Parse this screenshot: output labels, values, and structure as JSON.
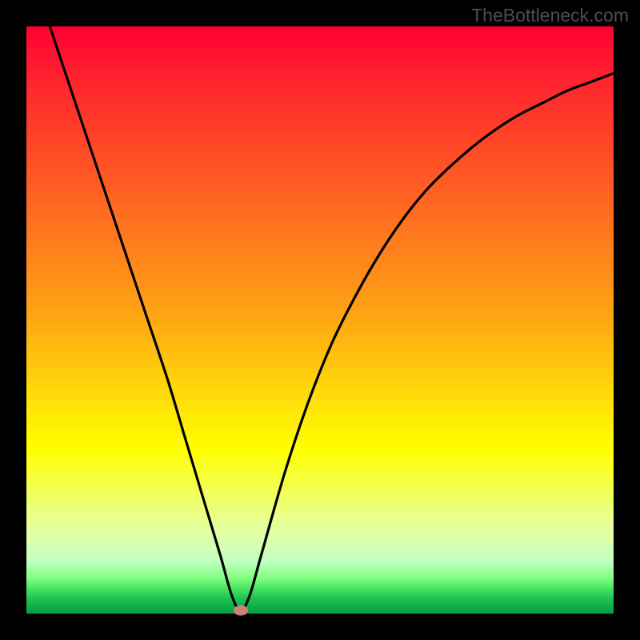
{
  "watermark": "TheBottleneck.com",
  "chart_data": {
    "type": "line",
    "title": "",
    "xlabel": "",
    "ylabel": "",
    "xlim": [
      0,
      100
    ],
    "ylim": [
      0,
      100
    ],
    "background_gradient": {
      "top_color": "#ff0030",
      "middle_color": "#ffff00",
      "bottom_color": "#00a040",
      "meaning": "vertical gradient red-yellow-green indicating bottleneck severity (high at top, low at bottom)"
    },
    "series": [
      {
        "name": "bottleneck-curve",
        "x": [
          4,
          8,
          12,
          16,
          20,
          24,
          27,
          30,
          33,
          35,
          36.5,
          38,
          40,
          44,
          48,
          52,
          56,
          60,
          64,
          68,
          72,
          76,
          80,
          84,
          88,
          92,
          96,
          100
        ],
        "y": [
          100,
          88,
          76,
          64,
          52,
          40,
          30,
          20,
          10,
          3,
          0.5,
          3,
          10,
          24,
          36,
          46,
          54,
          61,
          67,
          72,
          76,
          79.5,
          82.5,
          85,
          87,
          89,
          90.5,
          92
        ]
      }
    ],
    "marker": {
      "name": "optimal-point",
      "x": 36.5,
      "y": 0.5,
      "color": "#cb8377"
    }
  }
}
